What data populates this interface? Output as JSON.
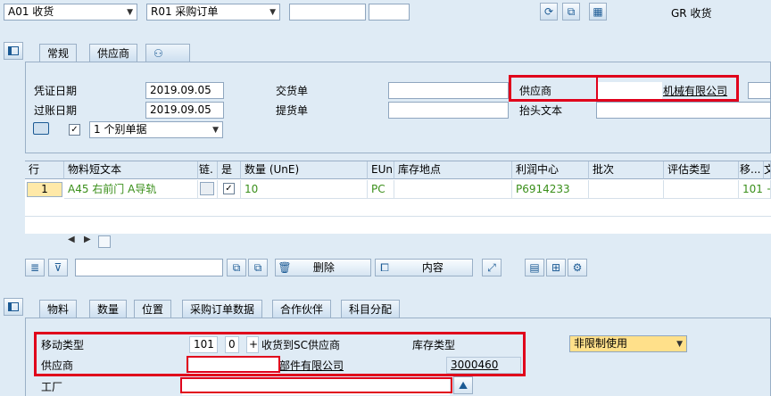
{
  "toolbar": {
    "transaction": "A01 收货",
    "reference": "R01 采购订单",
    "title": "GR 收货"
  },
  "header_tabs": [
    "常规",
    "供应商"
  ],
  "header": {
    "doc_date_label": "凭证日期",
    "doc_date": "2019.09.05",
    "post_date_label": "过账日期",
    "post_date": "2019.09.05",
    "delivery_note_label": "交货单",
    "bill_of_lading_label": "提货单",
    "vendor_label": "供应商",
    "vendor_name": "机械有限公司",
    "header_text_label": "抬头文本",
    "slip_option": "1 个别单据"
  },
  "grid": {
    "columns": [
      "行",
      "物料短文本",
      "链.",
      "是",
      "数量 (UnE)",
      "EUn",
      "库存地点",
      "利润中心",
      "批次",
      "评估类型",
      "移...",
      "文"
    ],
    "row": {
      "line": "1",
      "material_text": "A45 右前门 A导轨",
      "qty": "10",
      "unit": "PC",
      "profit_center": "P6914233",
      "movement": "101 +"
    }
  },
  "grid_buttons": {
    "delete": "删除",
    "contents": "内容"
  },
  "item_tabs": [
    "物料",
    "数量",
    "位置",
    "采购订单数据",
    "合作伙伴",
    "科目分配"
  ],
  "item": {
    "movement_type_label": "移动类型",
    "movement_type": "101",
    "movement_indicator": "0",
    "movement_sign": "+",
    "movement_desc": "收货到SC供应商",
    "stock_type_label": "库存类型",
    "stock_type": "非限制使用",
    "vendor_label": "供应商",
    "vendor_name": "部件有限公司",
    "vendor_code": "3000460",
    "plant_label": "工厂"
  },
  "colors": {
    "background": "#dfebf5",
    "highlight_red": "#e0001b",
    "grid_text_green": "#3a8f1a",
    "dropdown_highlight": "#ffe08a"
  }
}
